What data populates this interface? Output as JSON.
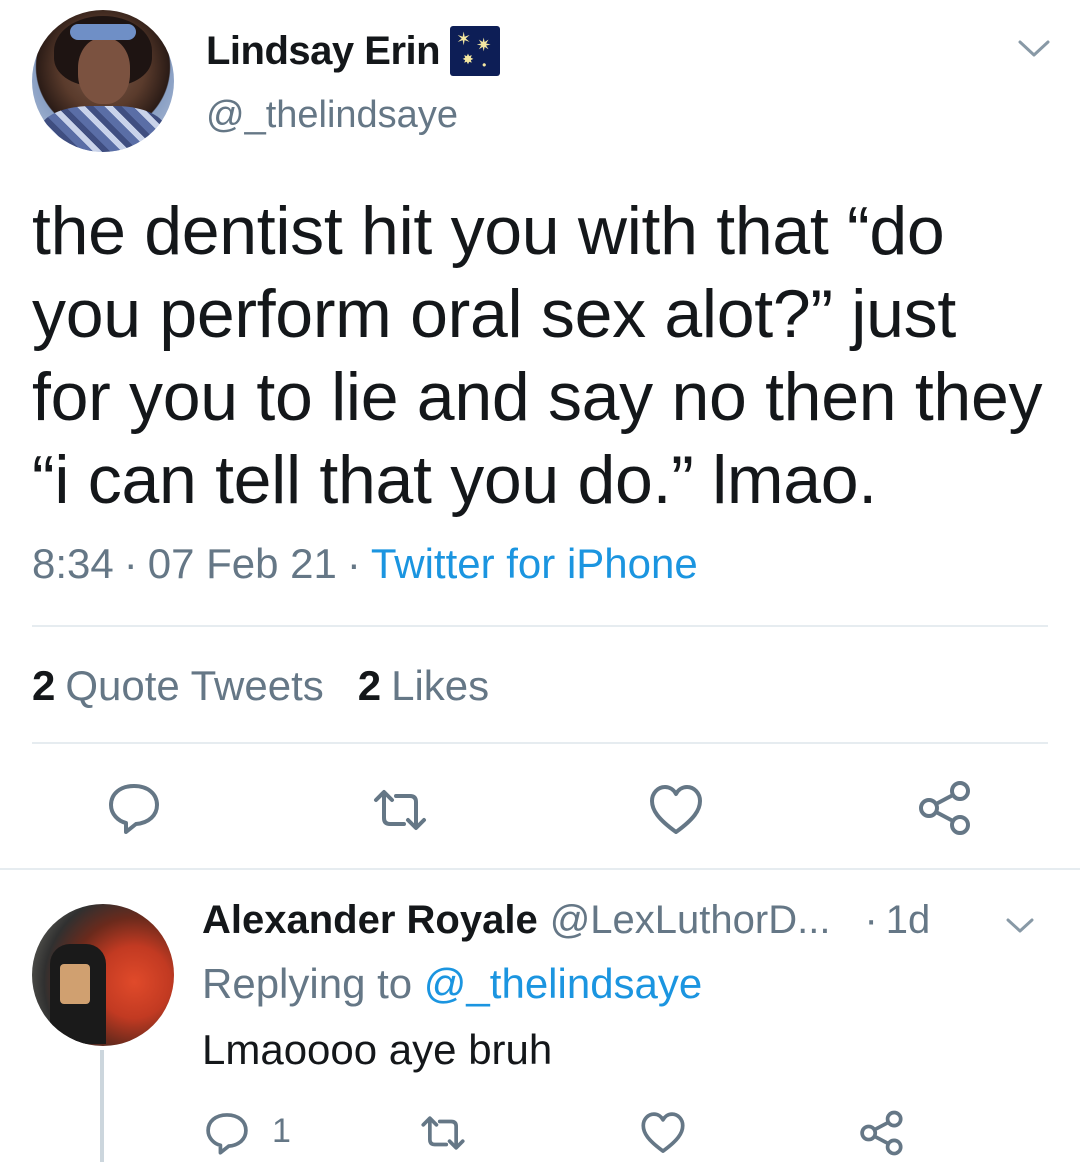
{
  "tweet": {
    "author_name": "Lindsay Erin",
    "author_emoji": "fireworks-emoji",
    "author_handle": "@_thelindsaye",
    "text": "the dentist hit you with that “do you perform oral sex alot?” just for you to lie and say no then they “i can tell that you do.” lmao.",
    "time": "8:34",
    "date": "07 Feb 21",
    "source": "Twitter for iPhone",
    "separator": "·",
    "stats": {
      "quote_tweets_count": "2",
      "quote_tweets_label": "Quote Tweets",
      "likes_count": "2",
      "likes_label": "Likes"
    },
    "actions": [
      "reply-icon",
      "retweet-icon",
      "like-icon",
      "share-icon"
    ]
  },
  "reply": {
    "author_name": "Alexander Royale",
    "author_handle": "@LexLuthorD...",
    "separator": "·",
    "age": "1d",
    "replying_prefix": "Replying to",
    "replying_to": "@_thelindsaye",
    "text": "Lmaoooo aye bruh",
    "reply_count": "1",
    "actions": [
      "reply-icon",
      "retweet-icon",
      "like-icon",
      "share-icon"
    ]
  },
  "colors": {
    "text": "#14171a",
    "secondary": "#657786",
    "accent": "#1b95e0",
    "divider": "#e6ecf0"
  }
}
